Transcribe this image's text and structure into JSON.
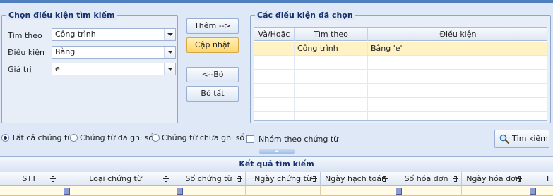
{
  "left_panel": {
    "title": "Chọn điều kiện tìm kiếm",
    "fields": [
      {
        "label": "Tìm theo",
        "value": "Công trình"
      },
      {
        "label": "Điều kiện",
        "value": "Bằng"
      },
      {
        "label": "Giá trị",
        "value": "e"
      }
    ]
  },
  "actions": {
    "add": "Thêm -->",
    "update": "Cập nhật",
    "remove": "<--Bỏ",
    "remove_all": "Bỏ tất"
  },
  "right_panel": {
    "title": "Các điều kiện đã chọn",
    "columns": [
      "Và/Hoặc",
      "Tìm theo",
      "Điều kiện"
    ],
    "rows": [
      {
        "andor": "",
        "field": "Công trình",
        "condition": "Bằng 'e'"
      }
    ]
  },
  "options": {
    "radios": [
      {
        "label": "Tất cả chứng từ",
        "checked": true
      },
      {
        "label": "Chứng từ đã ghi sổ",
        "checked": false
      },
      {
        "label": "Chứng từ chưa ghi sổ",
        "checked": false
      }
    ],
    "group_checkbox": "Nhóm theo chứng từ",
    "search_button": "Tìm kiếm"
  },
  "results": {
    "title": "Kết quả tìm kiếm",
    "columns": [
      "STT",
      "Loại chứng từ",
      "Số chứng từ",
      "Ngày chứng từ",
      "Ngày hạch toán",
      "Số hóa đơn",
      "Ngày hóa đơn",
      "T"
    ]
  },
  "colors": {
    "accent": "#4f7fbf",
    "selected_row": "#fff3c6",
    "active_button": "#ffd76a",
    "filter_row": "#fffbe6"
  },
  "icons": [
    "magnifier-icon",
    "pin-icon",
    "dropdown-arrow-icon",
    "filter-equals-icon",
    "filter-checkbox-icon"
  ]
}
